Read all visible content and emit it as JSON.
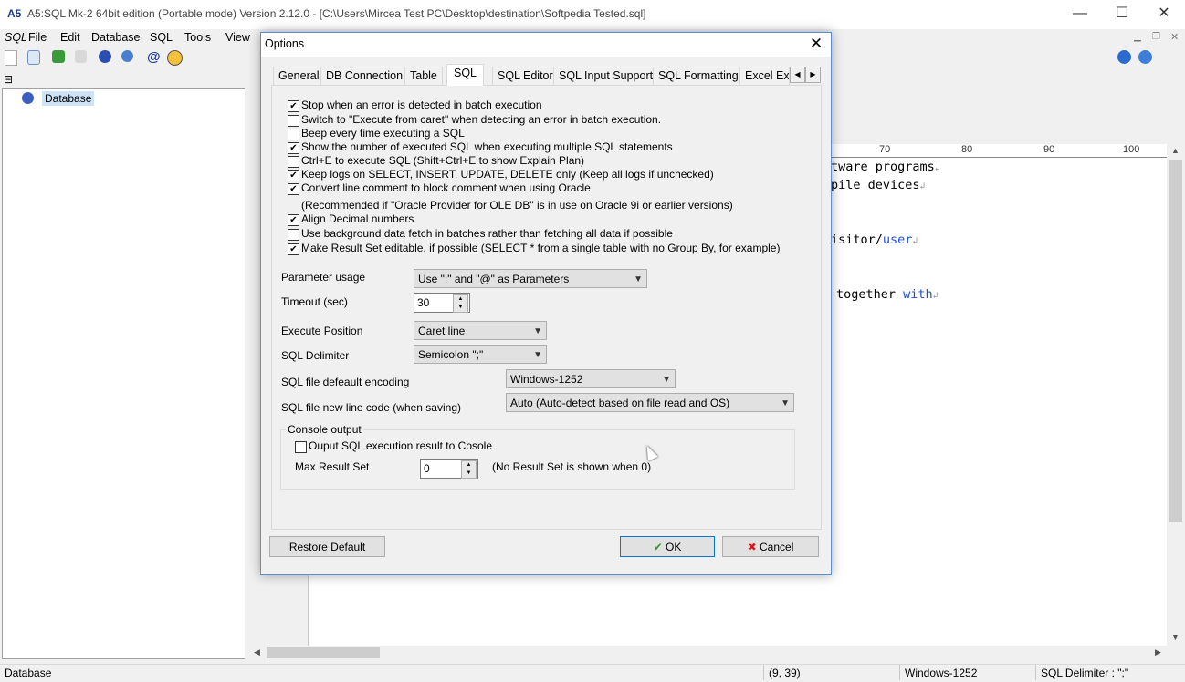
{
  "window": {
    "title": "A5:SQL Mk-2 64bit edition (Portable mode) Version 2.12.0 - [C:\\Users\\Mircea Test PC\\Desktop\\destination\\Softpedia Tested.sql]",
    "app_icon_text": "A5",
    "minimize": "—",
    "maximize": "☐",
    "close": "✕"
  },
  "menubar": {
    "items": [
      "SQL",
      "File",
      "Edit",
      "Database",
      "SQL",
      "Tools",
      "View"
    ]
  },
  "tree": {
    "root_label": "Database"
  },
  "editor": {
    "ruler": [
      "70",
      "80",
      "90",
      "100"
    ],
    "lines": [
      {
        "text": "tware programs",
        "blue": ""
      },
      {
        "text": "pile devices",
        "blue": ""
      },
      {
        "text": "isitor/",
        "blue": "user"
      },
      {
        "text": "together ",
        "blue": "with"
      }
    ],
    "newline_mark": "↲"
  },
  "statusbar": {
    "left": "Database",
    "position": "(9, 39)",
    "encoding": "Windows-1252",
    "delimiter": "SQL Delimiter : \";\""
  },
  "dialog": {
    "title": "Options",
    "close": "✕",
    "tabs": [
      "General",
      "DB Connection",
      "Table",
      "SQL",
      "SQL Editor",
      "SQL Input Support",
      "SQL Formatting",
      "Excel Exp"
    ],
    "active_tab": "SQL",
    "checkboxes": [
      {
        "label": "Stop when an error is detected in batch execution",
        "checked": true
      },
      {
        "label": "Switch to \"Execute from caret\" when detecting an error in batch execution.",
        "checked": false
      },
      {
        "label": "Beep every time executing a SQL",
        "checked": false
      },
      {
        "label": "Show the number of executed SQL when executing multiple SQL statements",
        "checked": true
      },
      {
        "label": "Ctrl+E to execute SQL (Shift+Ctrl+E to show Explain Plan)",
        "checked": false
      },
      {
        "label": "Keep logs on SELECT, INSERT, UPDATE, DELETE only (Keep all logs if unchecked)",
        "checked": true
      },
      {
        "label": "Convert line comment to block comment when using Oracle",
        "checked": true
      }
    ],
    "oracle_note": "(Recommended if \"Oracle Provider for OLE DB\" is in use on Oracle 9i or earlier versions)",
    "checkboxes2": [
      {
        "label": "Align Decimal numbers",
        "checked": true
      },
      {
        "label": "Use background data fetch in batches rather than fetching all data if possible",
        "checked": false
      },
      {
        "label": "Make Result Set editable, if possible (SELECT  * from a single table with no Group By, for example)",
        "checked": true
      }
    ],
    "parameter_usage": {
      "label": "Parameter usage",
      "value": "Use \":\" and \"@\" as Parameters"
    },
    "timeout": {
      "label": "Timeout (sec)",
      "value": "30"
    },
    "execute_position": {
      "label": "Execute Position",
      "value": "Caret line"
    },
    "sql_delimiter": {
      "label": "SQL Delimiter",
      "value": "Semicolon \";\""
    },
    "encoding": {
      "label": "SQL file defeault encoding",
      "value": "Windows-1252"
    },
    "newline": {
      "label": "SQL file new line code (when saving)",
      "value": "Auto (Auto-detect based on file read and OS)"
    },
    "console": {
      "legend": "Console output",
      "checkbox_label": "Ouput SQL execution result to Cosole",
      "checked": false,
      "max_label": "Max Result Set",
      "max_value": "0",
      "note": "(No Result Set is shown when 0)"
    },
    "buttons": {
      "restore": "Restore Default",
      "ok": "OK",
      "cancel": "Cancel"
    }
  }
}
